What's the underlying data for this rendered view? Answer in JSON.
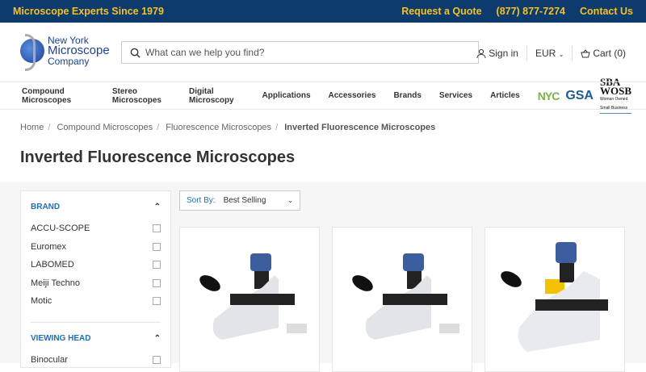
{
  "topbar": {
    "tagline": "Microscope Experts Since 1979",
    "quote": "Request a Quote",
    "phone": "(877) 877-7274",
    "contact": "Contact Us"
  },
  "logo": {
    "line1": "New York",
    "line2": "Microscope",
    "line3": "Company"
  },
  "search": {
    "placeholder": "What can we help you find?"
  },
  "account": {
    "sign_in": "Sign in",
    "currency": "EUR",
    "cart": "Cart (0)"
  },
  "nav": [
    "Compound Microscopes",
    "Stereo Microscopes",
    "Digital Microscopy",
    "Applications",
    "Accessories",
    "Brands",
    "Services",
    "Articles"
  ],
  "badges": {
    "nyc": "NYC",
    "gsa": "GSA",
    "sba": "SBA WOSB",
    "sba_sub": "Woman Owned Small Business"
  },
  "breadcrumb": [
    "Home",
    "Compound Microscopes",
    "Fluorescence Microscopes",
    "Inverted Fluorescence Microscopes"
  ],
  "title": "Inverted Fluorescence Microscopes",
  "filters": [
    {
      "title": "BRAND",
      "options": [
        "ACCU-SCOPE",
        "Euromex",
        "LABOMED",
        "Meiji Techno",
        "Motic"
      ]
    },
    {
      "title": "VIEWING HEAD",
      "options": [
        "Binocular"
      ]
    }
  ],
  "sort": {
    "label": "Sort By:",
    "value": "Best Selling"
  }
}
